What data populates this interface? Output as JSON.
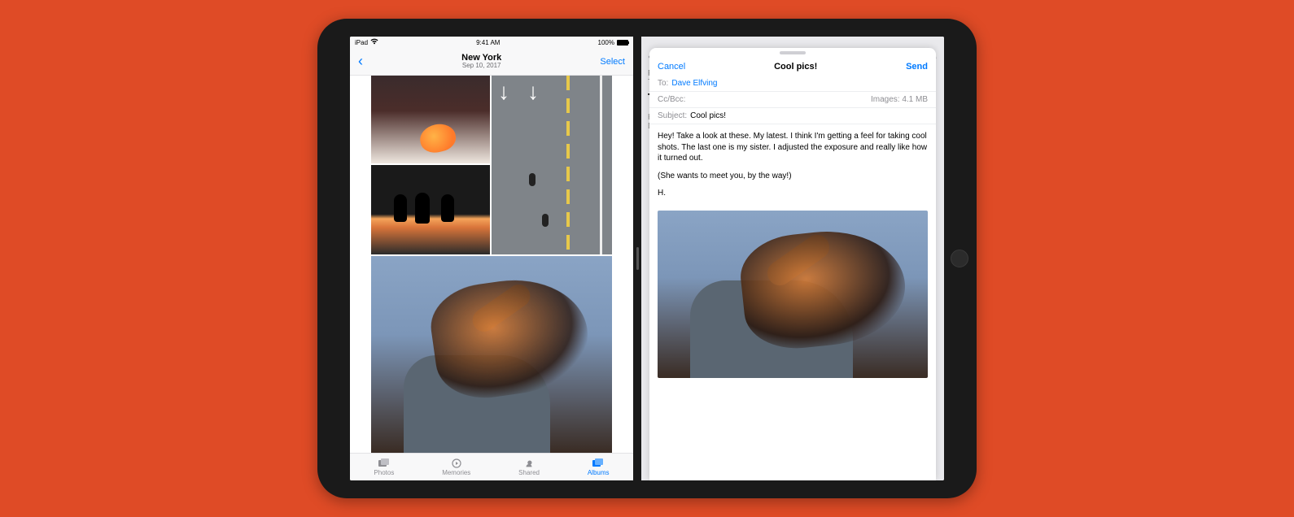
{
  "status": {
    "carrier": "iPad",
    "time": "9:41 AM",
    "battery_pct": "100%"
  },
  "photos": {
    "back_label": "‹",
    "title": "New York",
    "subtitle": "Sep 10, 2017",
    "select_label": "Select",
    "tabs": [
      {
        "id": "photos",
        "label": "Photos",
        "icon": "photos-icon"
      },
      {
        "id": "memories",
        "label": "Memories",
        "icon": "memories-icon"
      },
      {
        "id": "shared",
        "label": "Shared",
        "icon": "shared-icon"
      },
      {
        "id": "albums",
        "label": "Albums",
        "icon": "albums-icon"
      }
    ],
    "active_tab": "albums",
    "thumbnails": [
      {
        "name": "grapefruit-on-table"
      },
      {
        "name": "silhouettes-at-sunset"
      },
      {
        "name": "aerial-crosswalk"
      },
      {
        "name": "woman-hair-sunset"
      }
    ]
  },
  "compose": {
    "cancel_label": "Cancel",
    "send_label": "Send",
    "title": "Cool pics!",
    "to_label": "To:",
    "to_value": "Dave Elfving",
    "cc_label": "Cc/Bcc:",
    "images_label": "Images: 4.1 MB",
    "subject_label": "Subject:",
    "subject_value": "Cool pics!",
    "body_p1": "Hey! Take a look at these. My latest. I think I'm getting a feel for taking cool shots. The last one is my sister. I adjusted the exposure and really like how it turned out.",
    "body_p2": "(She wants to meet you, by the way!)",
    "body_sig": "H.",
    "attachment": {
      "name": "woman-hair-sunset"
    }
  },
  "background_mail": {
    "from_prefix": "F",
    "to_prefix": "T",
    "subj_initial": "T",
    "line1": "H",
    "line2": "D"
  }
}
